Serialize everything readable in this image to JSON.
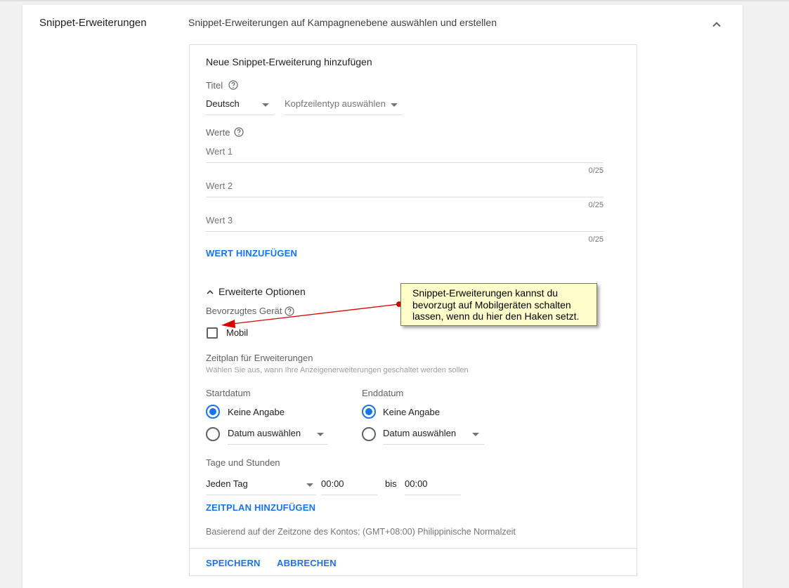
{
  "section": {
    "label": "Snippet-Erweiterungen",
    "description": "Snippet-Erweiterungen auf Kampagnenebene auswählen und erstellen"
  },
  "form": {
    "title": "Neue Snippet-Erweiterung hinzufügen",
    "titel_label": "Titel",
    "language_select": "Deutsch",
    "header_type_placeholder": "Kopfzeilentyp auswählen",
    "werte_label": "Werte",
    "values": [
      {
        "placeholder": "Wert 1",
        "counter": "0/25"
      },
      {
        "placeholder": "Wert 2",
        "counter": "0/25"
      },
      {
        "placeholder": "Wert 3",
        "counter": "0/25"
      }
    ],
    "add_value_label": "WERT HINZUFÜGEN",
    "advanced_options_label": "Erweiterte Optionen",
    "preferred_device_label": "Bevorzugtes Gerät",
    "mobile_label": "Mobil",
    "mobile_checked": false,
    "schedule_title": "Zeitplan für Erweiterungen",
    "schedule_hint": "Wählen Sie aus, wann Ihre Anzeigenerweiterungen geschaltet werden sollen",
    "start_label": "Startdatum",
    "end_label": "Enddatum",
    "no_value_label": "Keine Angabe",
    "choose_date_label": "Datum auswählen",
    "days_hours_label": "Tage und Stunden",
    "days_select": "Jeden Tag",
    "time_from": "00:00",
    "bis_label": "bis",
    "time_to": "00:00",
    "add_schedule_label": "ZEITPLAN HINZUFÜGEN",
    "timezone_note": "Basierend auf der Zeitzone des Kontos: (GMT+08:00) Philippinische Normalzeit",
    "save_label": "SPEICHERN",
    "cancel_label": "ABBRECHEN"
  },
  "annotation": {
    "text": "Snippet-Erweiterungen kannst du bevorzugt auf Mobilgeräten schalten lassen, wenn du hier den Haken setzt."
  },
  "colors": {
    "accent": "#1a73e8",
    "tooltip_bg": "#ffffcc",
    "arrow": "#d90000"
  },
  "icons": {
    "collapse": "chevron-up-icon",
    "help": "help-circle-icon",
    "advanced_toggle": "chevron-up-icon"
  }
}
